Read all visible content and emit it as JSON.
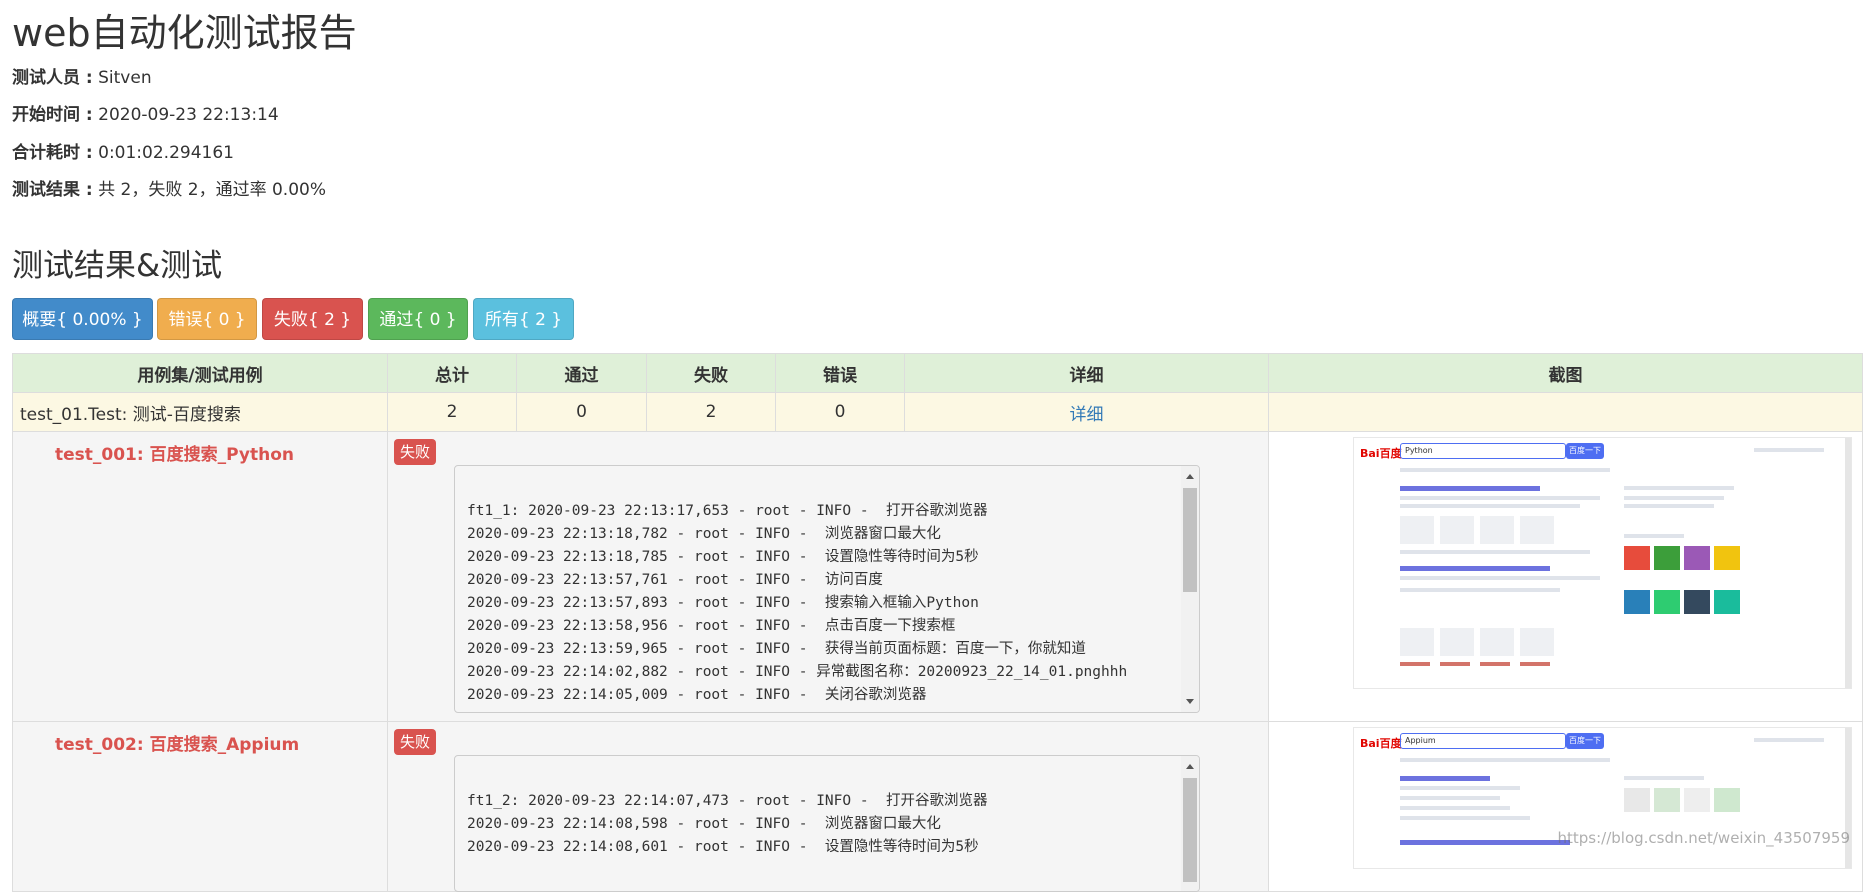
{
  "report": {
    "title": "web自动化测试报告",
    "tester_label": "测试人员 :",
    "tester": "Sitven",
    "start_label": "开始时间 :",
    "start": "2020-09-23 22:13:14",
    "duration_label": "合计耗时 :",
    "duration": "0:01:02.294161",
    "result_label": "测试结果 :",
    "result": "共 2，失败 2，通过率 0.00%"
  },
  "section_title": "测试结果&测试",
  "filters": [
    {
      "label": "概要{ 0.00% }",
      "color": "#428bca"
    },
    {
      "label": "错误{ 0 }",
      "color": "#f0ad4e"
    },
    {
      "label": "失败{ 2 }",
      "color": "#d9534f"
    },
    {
      "label": "通过{ 0 }",
      "color": "#5cb85c"
    },
    {
      "label": "所有{ 2 }",
      "color": "#5bc0de"
    }
  ],
  "table": {
    "headers": [
      "用例集/测试用例",
      "总计",
      "通过",
      "失败",
      "错误",
      "详细",
      "截图"
    ],
    "suite": {
      "name": "test_01.Test: 测试-百度搜索",
      "total": "2",
      "pass": "0",
      "fail": "2",
      "error": "0",
      "detail": "详细"
    },
    "cases": [
      {
        "name": "test_001: 百度搜索_Python",
        "status": "失败",
        "log": "ft1_1: 2020-09-23 22:13:17,653 - root - INFO -  打开谷歌浏览器\n2020-09-23 22:13:18,782 - root - INFO -  浏览器窗口最大化\n2020-09-23 22:13:18,785 - root - INFO -  设置隐性等待时间为5秒\n2020-09-23 22:13:57,761 - root - INFO -  访问百度\n2020-09-23 22:13:57,893 - root - INFO -  搜索输入框输入Python\n2020-09-23 22:13:58,956 - root - INFO -  点击百度一下搜索框\n2020-09-23 22:13:59,965 - root - INFO -  获得当前页面标题：百度一下，你就知道\n2020-09-23 22:14:02,882 - root - INFO - 异常截图名称：20200923_22_14_01.pnghhh\n2020-09-23 22:14:05,009 - root - INFO -  关闭谷歌浏览器",
        "shot_query": "Python"
      },
      {
        "name": "test_002: 百度搜索_Appium",
        "status": "失败",
        "log": "ft1_2: 2020-09-23 22:14:07,473 - root - INFO -  打开谷歌浏览器\n2020-09-23 22:14:08,598 - root - INFO -  浏览器窗口最大化\n2020-09-23 22:14:08,601 - root - INFO -  设置隐性等待时间为5秒",
        "shot_query": "Appium"
      }
    ]
  },
  "screenshot_text": {
    "logo_a": "Bai",
    "logo_b": "百度",
    "button": "百度一下"
  },
  "watermark": "https://blog.csdn.net/weixin_43507959"
}
